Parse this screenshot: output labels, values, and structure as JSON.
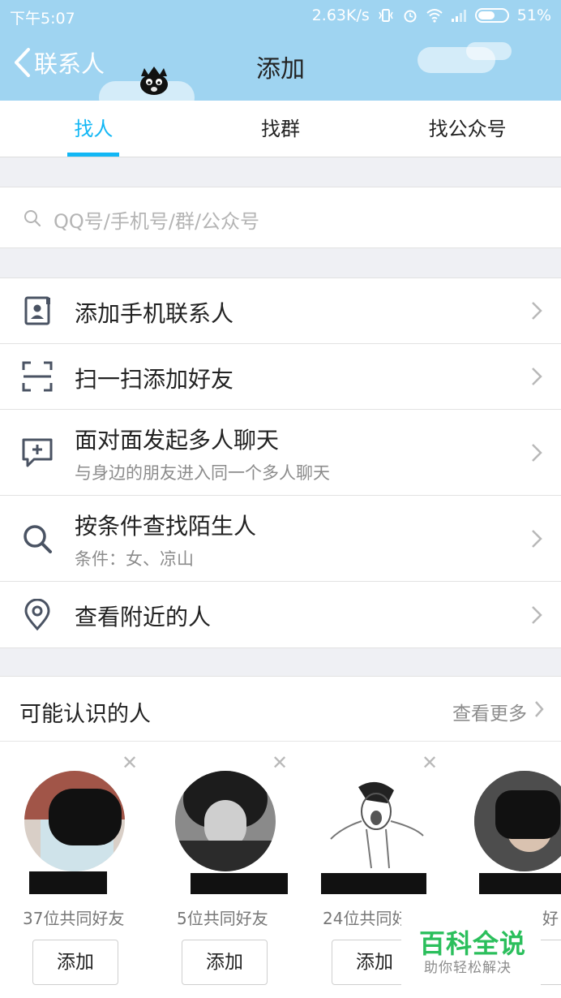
{
  "status": {
    "time": "下午5:07",
    "speed": "2.63K/s",
    "battery": "51%"
  },
  "nav": {
    "back_label": "联系人",
    "title": "添加"
  },
  "tabs": [
    {
      "label": "找人",
      "active": true
    },
    {
      "label": "找群",
      "active": false
    },
    {
      "label": "找公众号",
      "active": false
    }
  ],
  "search": {
    "placeholder": "QQ号/手机号/群/公众号"
  },
  "menu": [
    {
      "icon": "contact-card-icon",
      "title": "添加手机联系人",
      "subtitle": ""
    },
    {
      "icon": "scan-icon",
      "title": "扫一扫添加好友",
      "subtitle": ""
    },
    {
      "icon": "chat-plus-icon",
      "title": "面对面发起多人聊天",
      "subtitle": "与身边的朋友进入同一个多人聊天"
    },
    {
      "icon": "search-icon",
      "title": "按条件查找陌生人",
      "subtitle": "条件：女、凉山"
    },
    {
      "icon": "location-pin-icon",
      "title": "查看附近的人",
      "subtitle": ""
    }
  ],
  "maybe_know": {
    "title": "可能认识的人",
    "more": "查看更多",
    "people": [
      {
        "mutual": "37位共同好友",
        "button": "添加"
      },
      {
        "mutual": "5位共同好友",
        "button": "添加"
      },
      {
        "mutual": "24位共同好",
        "button": "添加"
      },
      {
        "mutual": "好",
        "button": ""
      }
    ]
  },
  "watermark": {
    "title": "百科全说",
    "subtitle": "助你轻松解决"
  },
  "colors": {
    "header_bg": "#9fd4f1",
    "accent": "#12b7f5",
    "watermark_green": "#2bbf5c"
  }
}
